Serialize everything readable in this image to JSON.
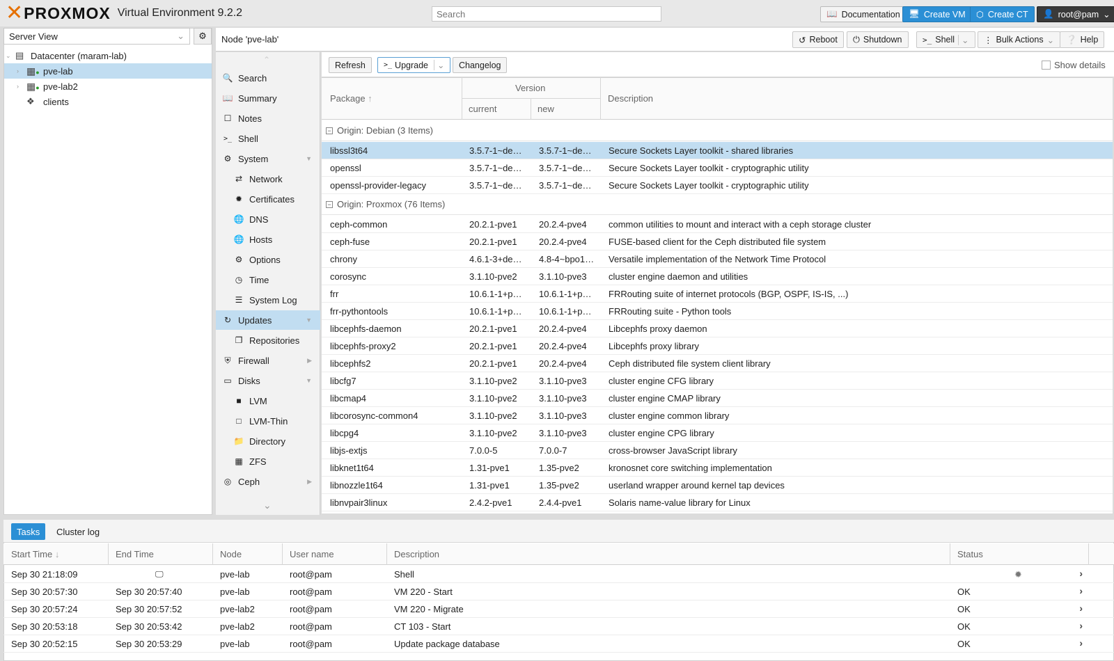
{
  "header": {
    "brand": "PROXMOX",
    "version_label": "Virtual Environment 9.2.2",
    "search_placeholder": "Search",
    "buttons": {
      "documentation": "Documentation",
      "create_vm": "Create VM",
      "create_ct": "Create CT",
      "user": "root@pam"
    }
  },
  "sidebar": {
    "view_selector": "Server View",
    "tree": [
      {
        "label": "Datacenter (maram-lab)",
        "icon": "datacenter-icon"
      },
      {
        "label": "pve-lab",
        "icon": "node-online-icon",
        "selected": true
      },
      {
        "label": "pve-lab2",
        "icon": "node-online-icon"
      },
      {
        "label": "clients",
        "icon": "tags-icon"
      }
    ]
  },
  "node_header": {
    "title": "Node 'pve-lab'",
    "buttons": {
      "reboot": "Reboot",
      "shutdown": "Shutdown",
      "shell": "Shell",
      "bulk_actions": "Bulk Actions",
      "help": "Help"
    }
  },
  "nav": [
    {
      "label": "Search",
      "icon": "search-icon"
    },
    {
      "label": "Summary",
      "icon": "book-icon"
    },
    {
      "label": "Notes",
      "icon": "notes-icon"
    },
    {
      "label": "Shell",
      "icon": "terminal-icon"
    },
    {
      "label": "System",
      "icon": "gears-icon",
      "expanded": true
    },
    {
      "label": "Network",
      "icon": "network-icon",
      "indent": true
    },
    {
      "label": "Certificates",
      "icon": "certificate-icon",
      "indent": true
    },
    {
      "label": "DNS",
      "icon": "globe-icon",
      "indent": true
    },
    {
      "label": "Hosts",
      "icon": "globe-icon",
      "indent": true
    },
    {
      "label": "Options",
      "icon": "gear-icon",
      "indent": true
    },
    {
      "label": "Time",
      "icon": "clock-icon",
      "indent": true
    },
    {
      "label": "System Log",
      "icon": "list-icon",
      "indent": true
    },
    {
      "label": "Updates",
      "icon": "refresh-icon",
      "selected": true,
      "expanded": true
    },
    {
      "label": "Repositories",
      "icon": "files-icon",
      "indent": true
    },
    {
      "label": "Firewall",
      "icon": "shield-icon",
      "collapsed": true
    },
    {
      "label": "Disks",
      "icon": "hdd-icon",
      "expanded": true
    },
    {
      "label": "LVM",
      "icon": "square-icon",
      "indent": true
    },
    {
      "label": "LVM-Thin",
      "icon": "square-outline-icon",
      "indent": true
    },
    {
      "label": "Directory",
      "icon": "folder-icon",
      "indent": true
    },
    {
      "label": "ZFS",
      "icon": "th-large-icon",
      "indent": true
    },
    {
      "label": "Ceph",
      "icon": "ceph-icon",
      "collapsed": true
    }
  ],
  "updates": {
    "toolbar": {
      "refresh": "Refresh",
      "upgrade": "Upgrade",
      "changelog": "Changelog",
      "show_details": "Show details"
    },
    "columns": {
      "package": "Package",
      "version": "Version",
      "current": "current",
      "new": "new",
      "description": "Description"
    },
    "groups": [
      {
        "label": "Origin: Debian (3 Items)",
        "rows": [
          [
            "libssl3t64",
            "3.5.7-1~de…",
            "3.5.7-1~de…",
            "Secure Sockets Layer toolkit - shared libraries"
          ],
          [
            "openssl",
            "3.5.7-1~de…",
            "3.5.7-1~de…",
            "Secure Sockets Layer toolkit - cryptographic utility"
          ],
          [
            "openssl-provider-legacy",
            "3.5.7-1~de…",
            "3.5.7-1~de…",
            "Secure Sockets Layer toolkit - cryptographic utility"
          ]
        ]
      },
      {
        "label": "Origin: Proxmox (76 Items)",
        "rows": [
          [
            "ceph-common",
            "20.2.1-pve1",
            "20.2.4-pve4",
            "common utilities to mount and interact with a ceph storage cluster"
          ],
          [
            "ceph-fuse",
            "20.2.1-pve1",
            "20.2.4-pve4",
            "FUSE-based client for the Ceph distributed file system"
          ],
          [
            "chrony",
            "4.6.1-3+de…",
            "4.8-4~bpo1…",
            "Versatile implementation of the Network Time Protocol"
          ],
          [
            "corosync",
            "3.1.10-pve2",
            "3.1.10-pve3",
            "cluster engine daemon and utilities"
          ],
          [
            "frr",
            "10.6.1-1+p…",
            "10.6.1-1+p…",
            "FRRouting suite of internet protocols (BGP, OSPF, IS-IS, ...)"
          ],
          [
            "frr-pythontools",
            "10.6.1-1+p…",
            "10.6.1-1+p…",
            "FRRouting suite - Python tools"
          ],
          [
            "libcephfs-daemon",
            "20.2.1-pve1",
            "20.2.4-pve4",
            "Libcephfs proxy daemon"
          ],
          [
            "libcephfs-proxy2",
            "20.2.1-pve1",
            "20.2.4-pve4",
            "Libcephfs proxy library"
          ],
          [
            "libcephfs2",
            "20.2.1-pve1",
            "20.2.4-pve4",
            "Ceph distributed file system client library"
          ],
          [
            "libcfg7",
            "3.1.10-pve2",
            "3.1.10-pve3",
            "cluster engine CFG library"
          ],
          [
            "libcmap4",
            "3.1.10-pve2",
            "3.1.10-pve3",
            "cluster engine CMAP library"
          ],
          [
            "libcorosync-common4",
            "3.1.10-pve2",
            "3.1.10-pve3",
            "cluster engine common library"
          ],
          [
            "libcpg4",
            "3.1.10-pve2",
            "3.1.10-pve3",
            "cluster engine CPG library"
          ],
          [
            "libjs-extjs",
            "7.0.0-5",
            "7.0.0-7",
            "cross-browser JavaScript library"
          ],
          [
            "libknet1t64",
            "1.31-pve1",
            "1.35-pve2",
            "kronosnet core switching implementation"
          ],
          [
            "libnozzle1t64",
            "1.31-pve1",
            "1.35-pve2",
            "userland wrapper around kernel tap devices"
          ],
          [
            "libnvpair3linux",
            "2.4.2-pve1",
            "2.4.4-pve1",
            "Solaris name-value library for Linux"
          ]
        ]
      }
    ]
  },
  "tasks": {
    "tabs": [
      "Tasks",
      "Cluster log"
    ],
    "columns": [
      "Start Time",
      "End Time",
      "Node",
      "User name",
      "Description",
      "Status"
    ],
    "rows": [
      [
        "Sep 30 21:18:09",
        "",
        "pve-lab",
        "root@pam",
        "Shell",
        ""
      ],
      [
        "Sep 30 20:57:30",
        "Sep 30 20:57:40",
        "pve-lab",
        "root@pam",
        "VM 220 - Start",
        "OK"
      ],
      [
        "Sep 30 20:57:24",
        "Sep 30 20:57:52",
        "pve-lab2",
        "root@pam",
        "VM 220 - Migrate",
        "OK"
      ],
      [
        "Sep 30 20:53:18",
        "Sep 30 20:53:42",
        "pve-lab2",
        "root@pam",
        "CT 103 - Start",
        "OK"
      ],
      [
        "Sep 30 20:52:15",
        "Sep 30 20:53:29",
        "pve-lab",
        "root@pam",
        "Update package database",
        "OK"
      ]
    ]
  },
  "colors": {
    "accent": "#2b8fd5",
    "selection": "#c1ddf1",
    "brand_orange": "#e57000"
  }
}
